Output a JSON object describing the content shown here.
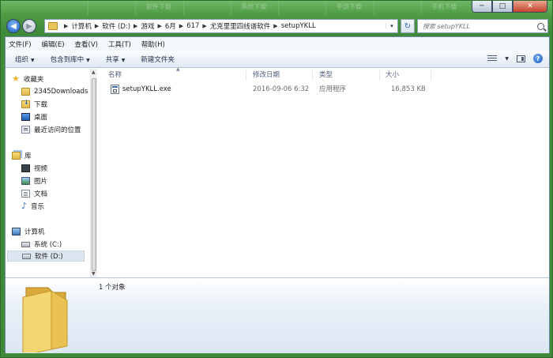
{
  "titlebar": {
    "ghost_tabs": [
      "",
      "软件下载",
      "",
      "系统下载",
      "",
      "手游下载",
      "",
      "手机下载"
    ],
    "minimize": "─",
    "maximize": "□",
    "close": "✕"
  },
  "address_bar": {
    "crumbs": [
      "计算机",
      "软件 (D:)",
      "游戏",
      "6月",
      "617",
      "尤克里里四线谱软件",
      "setupYKLL"
    ],
    "dropdown_glyph": "▾",
    "refresh_glyph": "↻"
  },
  "search": {
    "placeholder": "搜索 setupYKLL"
  },
  "menubar": {
    "items": [
      "文件(F)",
      "编辑(E)",
      "查看(V)",
      "工具(T)",
      "帮助(H)"
    ]
  },
  "toolbar": {
    "organize": "组织",
    "include_in_library": "包含到库中",
    "share": "共享",
    "new_folder": "新建文件夹",
    "help": "?"
  },
  "navpane": {
    "favorites": "收藏夹",
    "favorite_items": [
      "2345Downloads",
      "下载",
      "桌面",
      "最近访问的位置"
    ],
    "libraries": "库",
    "library_items": [
      "视频",
      "图片",
      "文档",
      "音乐"
    ],
    "computer": "计算机",
    "drives": [
      "系统 (C:)",
      "软件 (D:)"
    ]
  },
  "filelist": {
    "columns": [
      "名称",
      "修改日期",
      "类型",
      "大小"
    ],
    "files": [
      {
        "name": "setupYKLL.exe",
        "modified": "2016-09-06 6:32",
        "type": "应用程序",
        "size": "16,853 KB"
      }
    ]
  },
  "details_pane": {
    "status": "1 个对象"
  },
  "colors": {
    "frame_green": "#4f9a45",
    "selection": "#dde6f0",
    "folder": "#e3b84a"
  }
}
